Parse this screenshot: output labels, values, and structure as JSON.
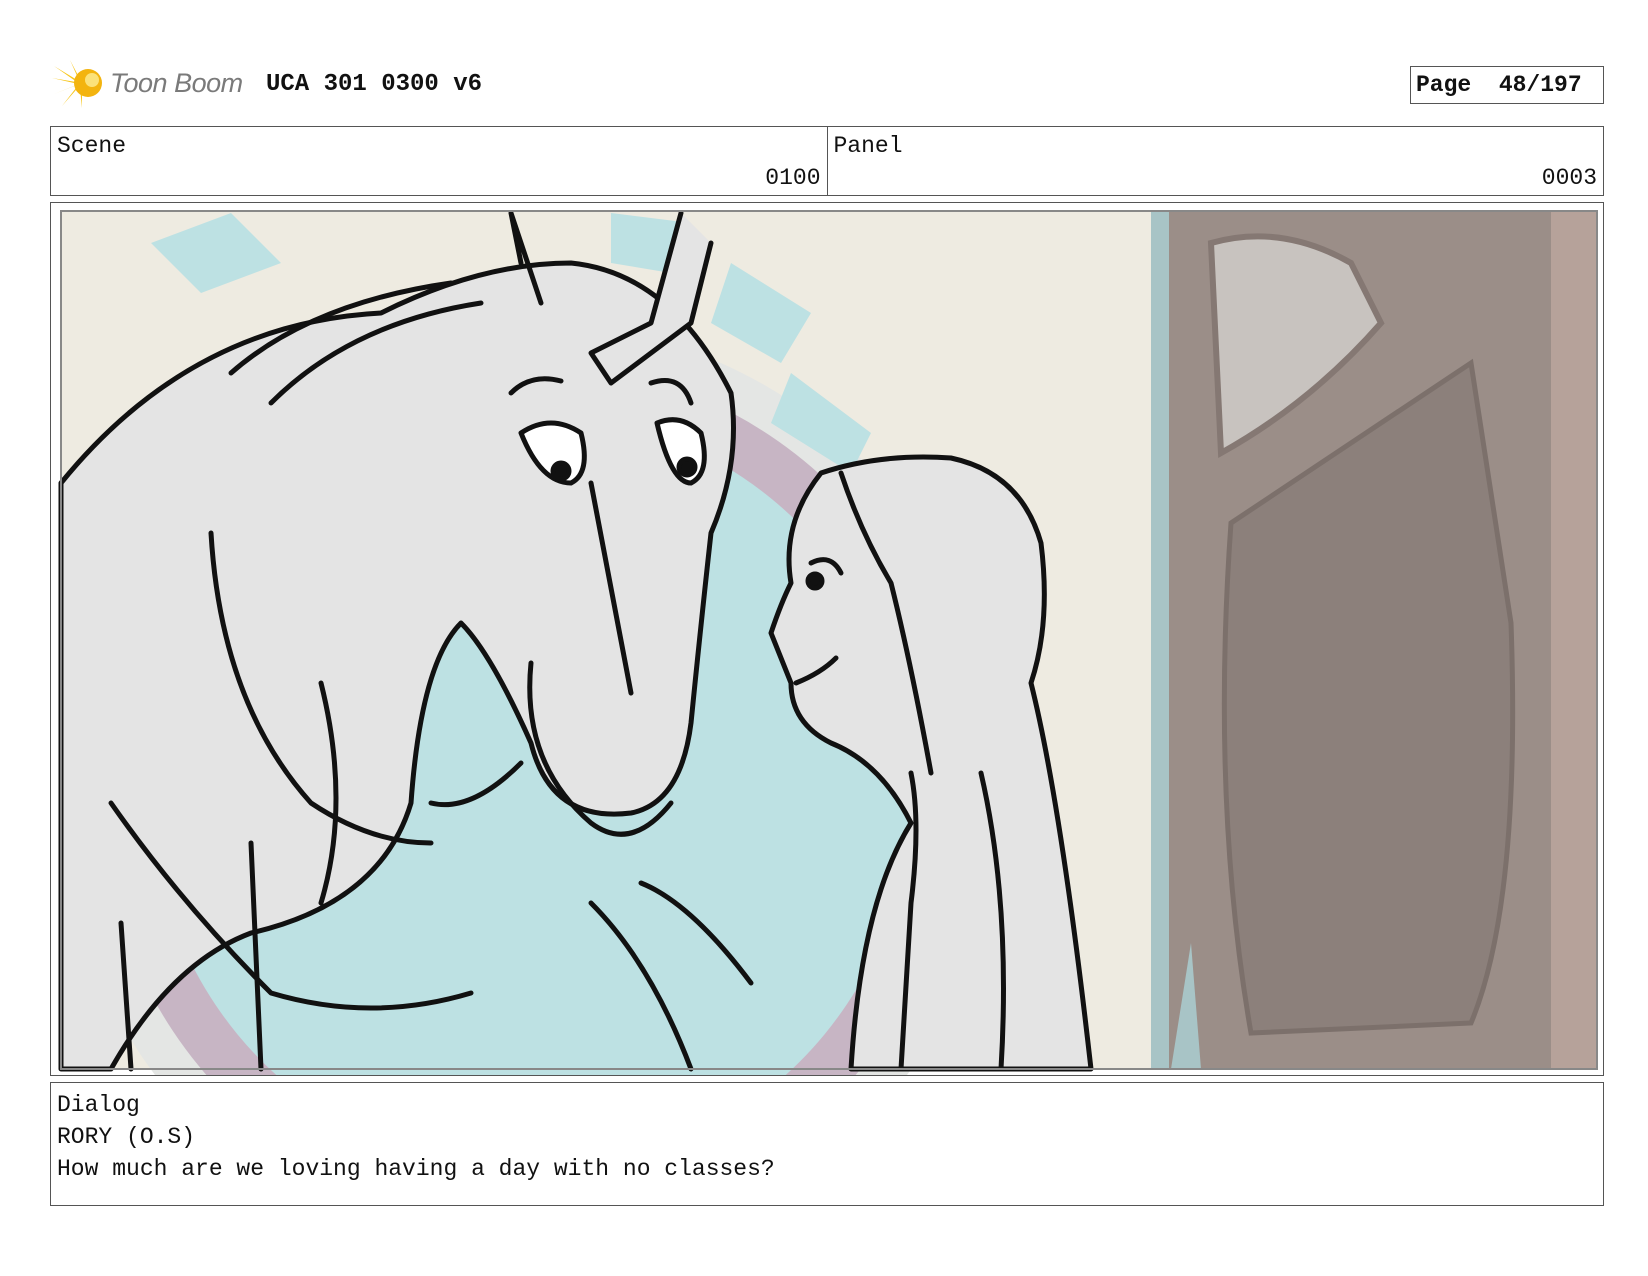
{
  "header": {
    "logo_text": "Toon Boom",
    "title": "UCA 301 0300 v6",
    "page_label": "Page",
    "page_number": "48/197"
  },
  "info": {
    "scene_label": "Scene",
    "scene_value": "0100",
    "panel_label": "Panel",
    "panel_value": "0003"
  },
  "dialog": {
    "label": "Dialog",
    "speaker": "RORY (O.S)",
    "line": "How much are we loving having a day with no classes?"
  }
}
